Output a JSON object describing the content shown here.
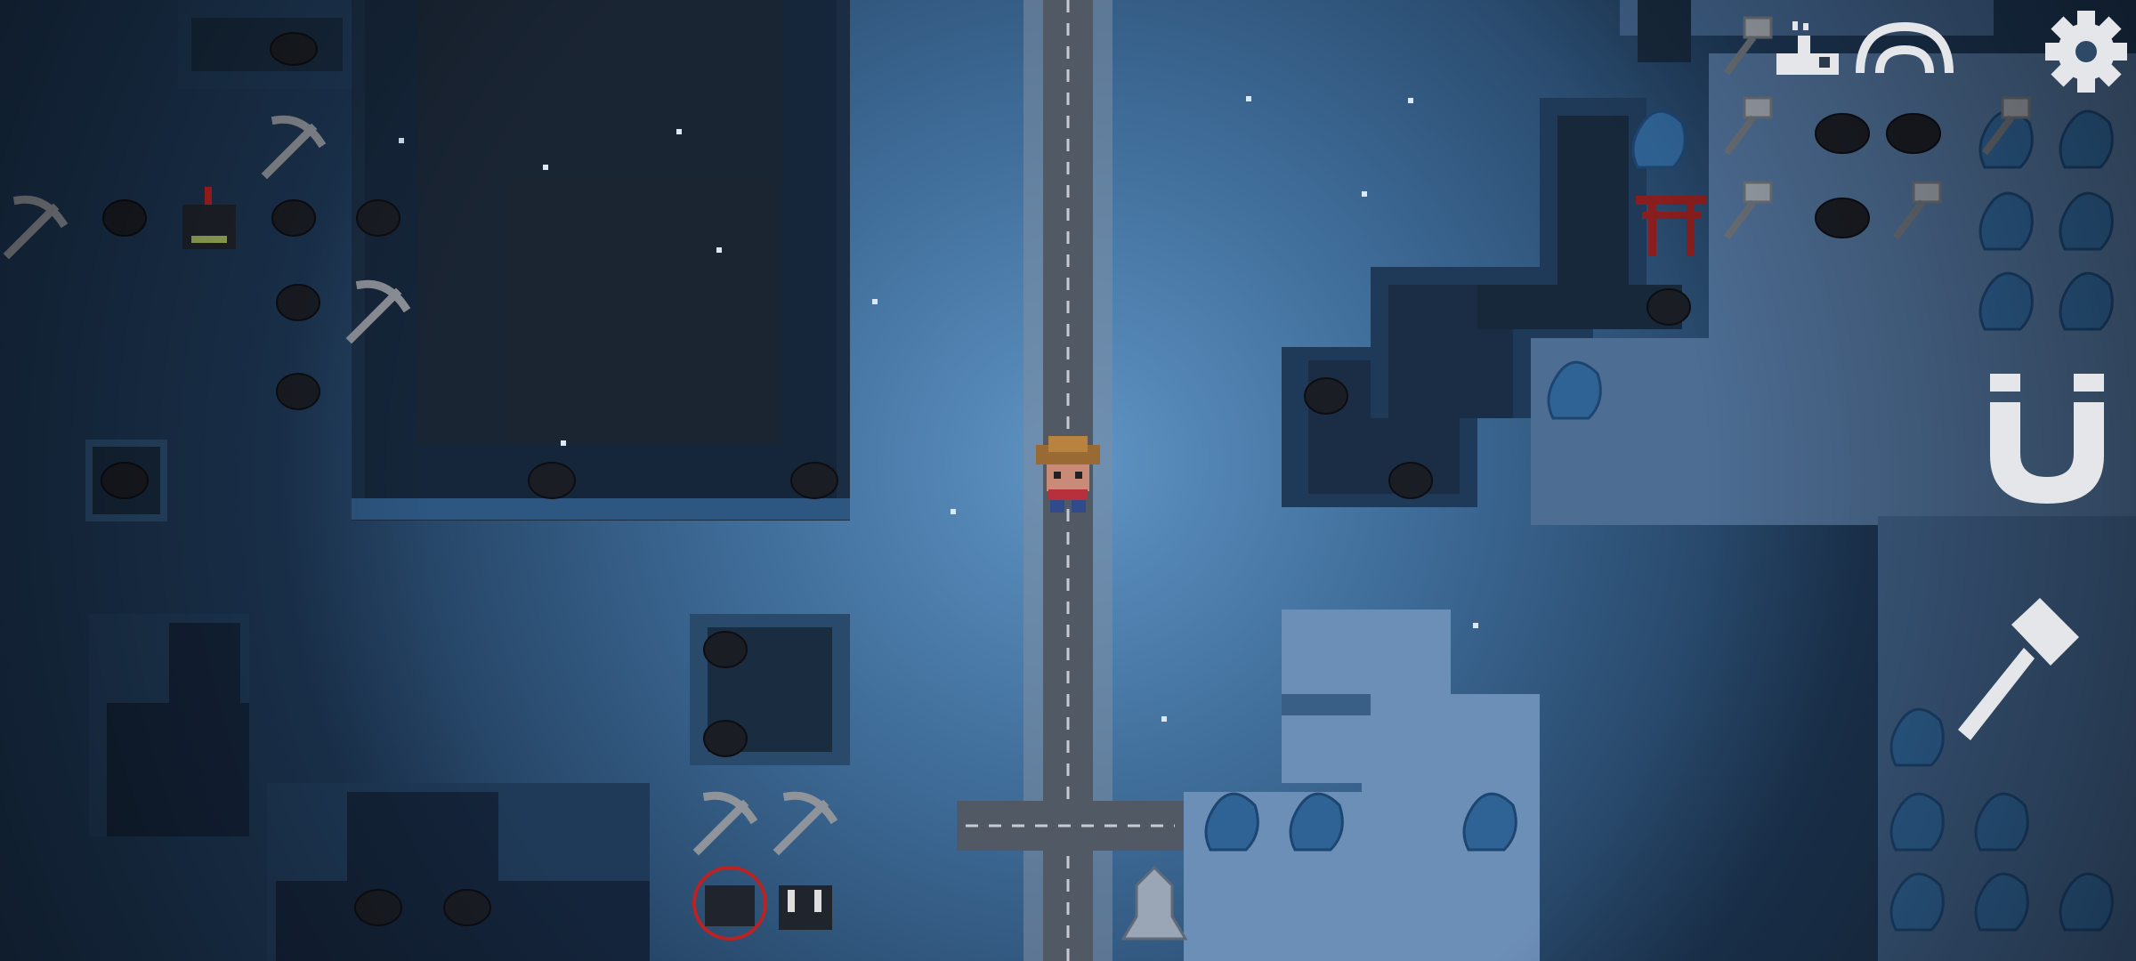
{
  "game": {
    "scene": "snowy-night-mining-map",
    "player": {
      "facing": "down"
    },
    "hud": {
      "status_icons": [
        "player-count-icon",
        "connection-signal-icon"
      ],
      "settings_icon": "gear-icon",
      "magnet_icon": "magnet-icon",
      "build_tool_icon": "hammer-icon"
    }
  },
  "colors": {
    "snow": "#4a7fb0",
    "snow_light": "#7fa8d0",
    "pit": "#15273a",
    "road": "#555d68",
    "road_line": "#c8ccd2",
    "hud_white": "#e4e6ea",
    "bush": "#2f6395",
    "rock": "#1a1d24"
  }
}
